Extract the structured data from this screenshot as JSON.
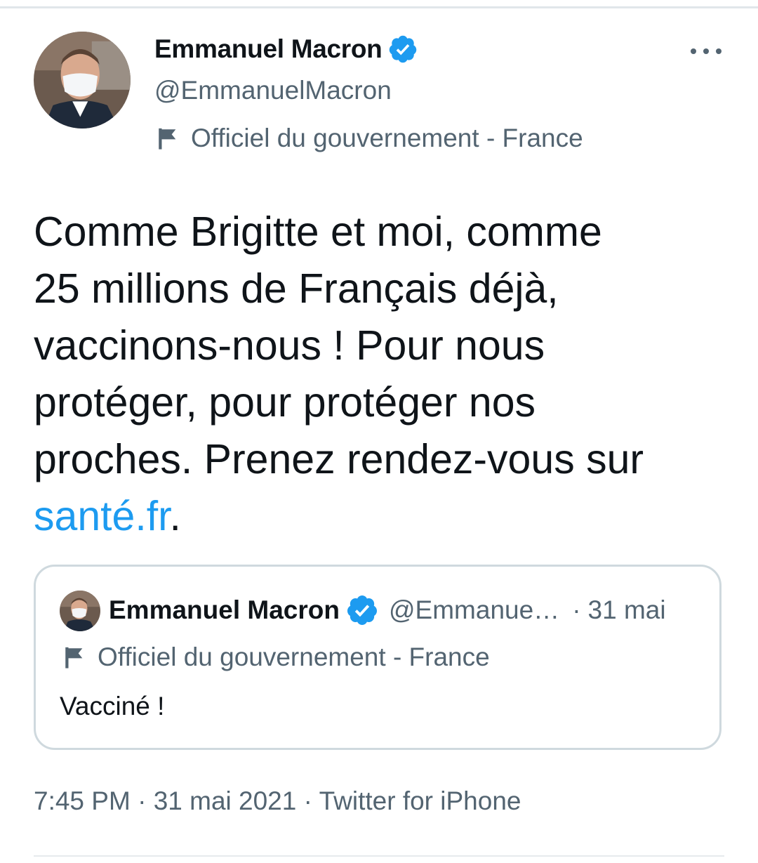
{
  "tweet": {
    "author": {
      "name": "Emmanuel Macron",
      "handle": "@EmmanuelMacron",
      "label": "Officiel du gouvernement - France"
    },
    "text_lines": [
      "Comme Brigitte et moi, comme",
      "25 millions de Français déjà,",
      "vaccinons-nous ! Pour nous",
      "protéger, pour protéger nos",
      "proches. Prenez rendez-vous sur"
    ],
    "link_text": "santé.fr",
    "link_suffix": ".",
    "timestamp": "7:45 PM",
    "date": "31 mai 2021",
    "source": "Twitter for iPhone",
    "separator": "·"
  },
  "quoted_tweet": {
    "name": "Emmanuel Macron",
    "handle": "@Emmanue…",
    "separator": "·",
    "date": "31 mai",
    "label": "Officiel du gouvernement - France",
    "text": "Vacciné !"
  },
  "icons": {
    "verified": "verified-badge-icon",
    "more": "more-options-icon",
    "flag": "flag-icon"
  },
  "colors": {
    "link": "#1d9bf0",
    "secondary_text": "#536471",
    "verified": "#1d9bf0",
    "border": "#cfd9de"
  }
}
